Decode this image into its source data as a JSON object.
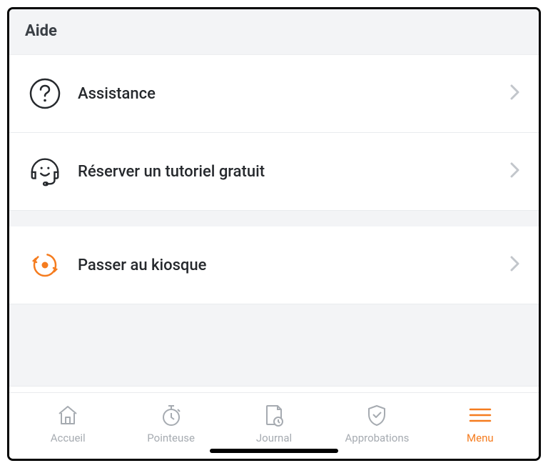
{
  "header": {
    "title": "Aide"
  },
  "items": [
    {
      "label": "Assistance",
      "icon": "question-circle"
    },
    {
      "label": "Réserver un tutoriel gratuit",
      "icon": "headset"
    },
    {
      "label": "Passer au kiosque",
      "icon": "kiosk-swap"
    }
  ],
  "tabs": [
    {
      "label": "Accueil",
      "icon": "home",
      "active": false
    },
    {
      "label": "Pointeuse",
      "icon": "stopwatch",
      "active": false
    },
    {
      "label": "Journal",
      "icon": "journal-clock",
      "active": false
    },
    {
      "label": "Approbations",
      "icon": "shield-check",
      "active": false
    },
    {
      "label": "Menu",
      "icon": "menu-lines",
      "active": true
    }
  ],
  "colors": {
    "accent": "#f57c1f",
    "muted": "#a6abb1",
    "text": "#26292d"
  }
}
